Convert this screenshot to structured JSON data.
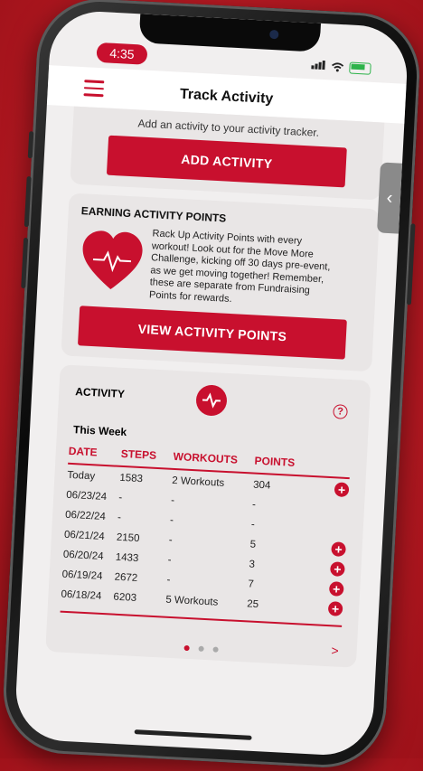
{
  "status_bar": {
    "time": "4:35"
  },
  "header": {
    "title": "Track Activity"
  },
  "add_card": {
    "text": "Add an activity to your activity tracker.",
    "button": "ADD ACTIVITY"
  },
  "points_card": {
    "title": "EARNING ACTIVITY POINTS",
    "description": "Rack Up Activity Points with every workout! Look out for the Move More Challenge, kicking off 30 days pre-event, as we get moving together! Remember, these are separate from Fundraising Points for rewards.",
    "button": "VIEW ACTIVITY POINTS"
  },
  "activity_card": {
    "title": "ACTIVITY",
    "help": "?",
    "period": "This Week",
    "columns": [
      "DATE",
      "STEPS",
      "WORKOUTS",
      "POINTS"
    ],
    "rows": [
      {
        "date": "Today",
        "steps": "1583",
        "workouts": "2 Workouts",
        "points": "304",
        "add": true
      },
      {
        "date": "06/23/24",
        "steps": "-",
        "workouts": "-",
        "points": "-",
        "add": false
      },
      {
        "date": "06/22/24",
        "steps": "-",
        "workouts": "-",
        "points": "-",
        "add": false
      },
      {
        "date": "06/21/24",
        "steps": "2150",
        "workouts": "-",
        "points": "5",
        "add": true
      },
      {
        "date": "06/20/24",
        "steps": "1433",
        "workouts": "-",
        "points": "3",
        "add": true
      },
      {
        "date": "06/19/24",
        "steps": "2672",
        "workouts": "-",
        "points": "7",
        "add": true
      },
      {
        "date": "06/18/24",
        "steps": "6203",
        "workouts": "5 Workouts",
        "points": "25",
        "add": true
      }
    ],
    "next": ">"
  },
  "side_tab": "‹",
  "colors": {
    "accent": "#c8102e",
    "background": "#c41e26"
  }
}
